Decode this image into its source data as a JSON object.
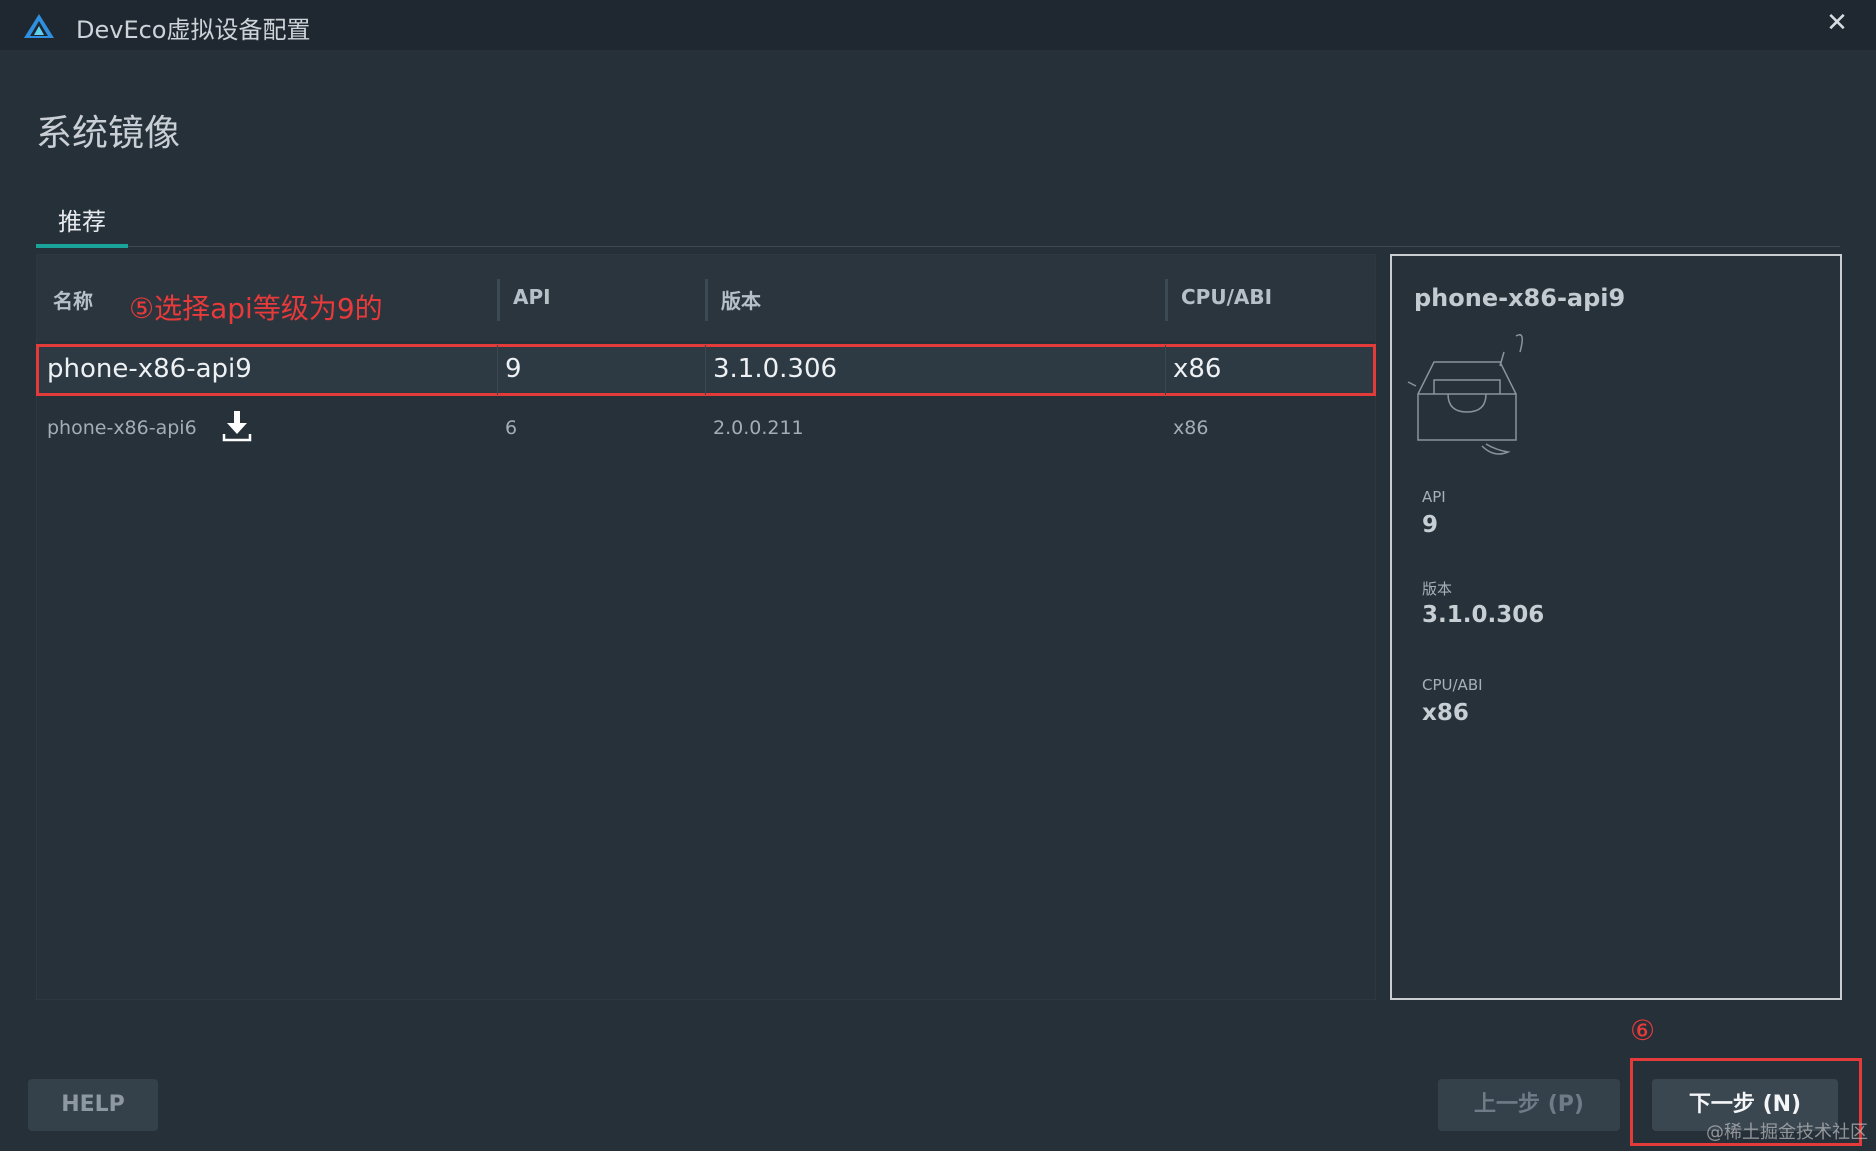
{
  "window": {
    "title": "DevEco虚拟设备配置",
    "close_glyph": "✕"
  },
  "page": {
    "title": "系统镜像"
  },
  "tabs": [
    {
      "label": "推荐",
      "active": true
    }
  ],
  "table": {
    "headers": {
      "name": "名称",
      "api": "API",
      "version": "版本",
      "cpu": "CPU/ABI"
    },
    "rows": [
      {
        "name": "phone-x86-api9",
        "api": "9",
        "version": "3.1.0.306",
        "cpu": "x86",
        "selected": true
      },
      {
        "name": "phone-x86-api6",
        "api": "6",
        "version": "2.0.0.211",
        "cpu": "x86",
        "selected": false,
        "icon": "download-icon"
      }
    ]
  },
  "annotations": {
    "step5": "⑤选择api等级为9的",
    "step6": "⑥"
  },
  "detail": {
    "title": "phone-x86-api9",
    "api_label": "API",
    "api_value": "9",
    "version_label": "版本",
    "version_value": "3.1.0.306",
    "cpu_label": "CPU/ABI",
    "cpu_value": "x86"
  },
  "buttons": {
    "help": "HELP",
    "prev": "上一步 (P)",
    "next": "下一步 (N)"
  },
  "watermark": "@稀土掘金技术社区",
  "colors": {
    "accent": "#1aa39a",
    "annotation_red": "#e33a3a",
    "background": "#263039"
  }
}
